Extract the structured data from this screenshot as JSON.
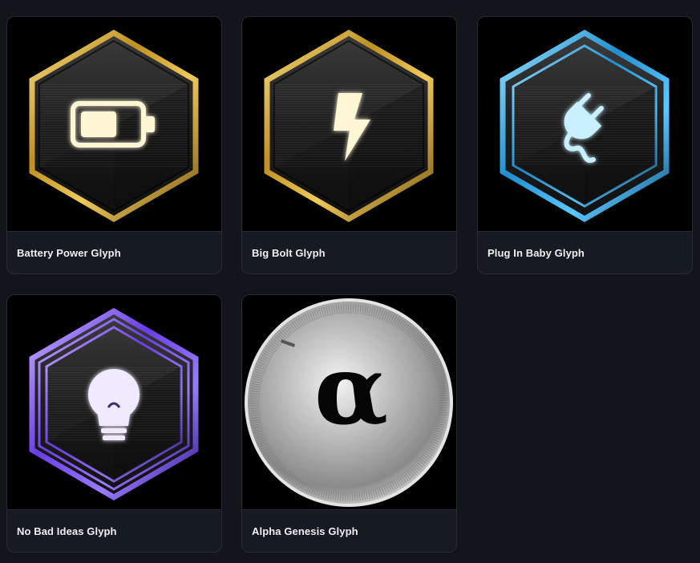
{
  "glyphs": [
    {
      "name": "Battery Power Glyph",
      "icon": "battery-icon",
      "style": "hexagon",
      "frame_color": "#d9ad3a"
    },
    {
      "name": "Big Bolt Glyph",
      "icon": "lightning-bolt-icon",
      "style": "hexagon",
      "frame_color": "#d9ad3a"
    },
    {
      "name": "Plug In Baby Glyph",
      "icon": "plug-icon",
      "style": "hexagon",
      "frame_color": "#2fa8e6"
    },
    {
      "name": "No Bad Ideas Glyph",
      "icon": "lightbulb-icon",
      "style": "hexagon",
      "frame_color": "#7a52f0"
    },
    {
      "name": "Alpha Genesis Glyph",
      "icon": "alpha-coin-icon",
      "style": "coin",
      "symbol": "α"
    }
  ],
  "colors": {
    "page_background": "#12151c",
    "card_background": "#161a22",
    "card_border": "#262b35",
    "gold": "#d9ad3a",
    "blue": "#2fa8e6",
    "purple": "#7a52f0",
    "silver": "#c9c9c9"
  }
}
